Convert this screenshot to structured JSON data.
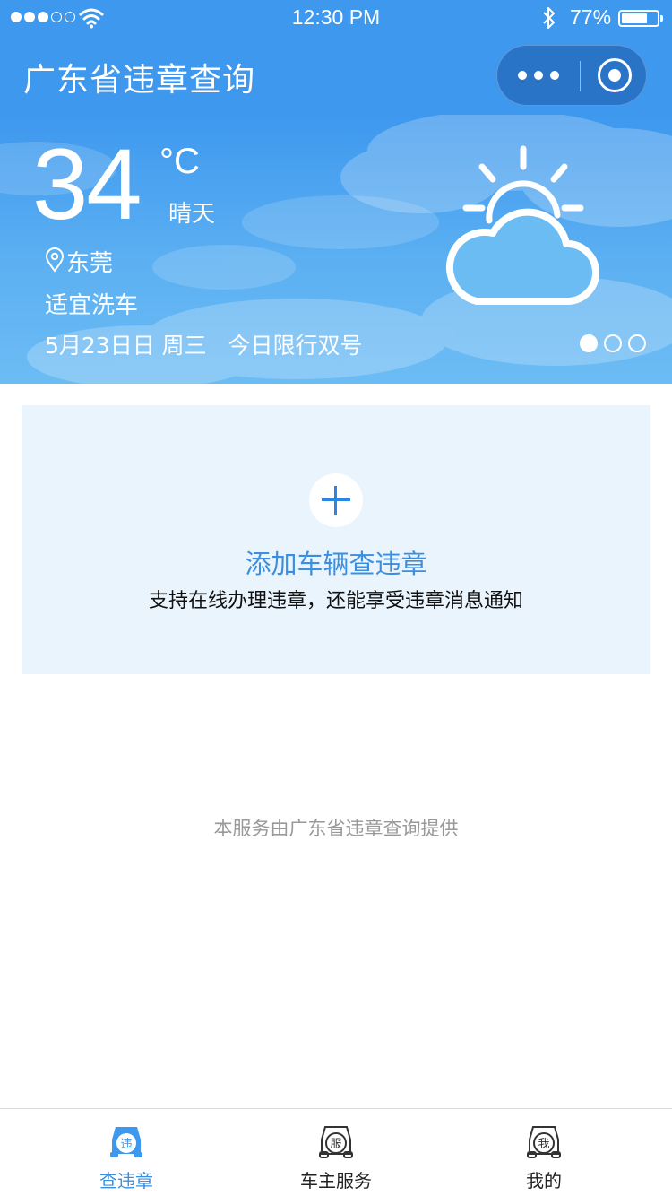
{
  "status_bar": {
    "time": "12:30 PM",
    "battery_percent": "77%",
    "battery_level": 0.77,
    "signal_bars_filled": 3,
    "signal_bars_total": 5
  },
  "nav": {
    "title": "广东省违章查询",
    "more_icon": "more-dots-icon",
    "close_icon": "target-close-icon"
  },
  "weather": {
    "temperature": "34",
    "unit": "°C",
    "condition": "晴天",
    "city": "东莞",
    "car_wash": "适宜洗车",
    "date_line": "5月23日日 周三   今日限行双号",
    "icon": "sun-cloud-icon",
    "pages": 3,
    "active_page": 0
  },
  "add_vehicle": {
    "title": "添加车辆查违章",
    "subtitle": "支持在线办理违章，还能享受违章消息通知"
  },
  "footer": {
    "provider": "本服务由广东省违章查询提供"
  },
  "tab_bar": {
    "tabs": [
      {
        "label": "查违章",
        "badge": "违",
        "active": true
      },
      {
        "label": "车主服务",
        "badge": "服",
        "active": false
      },
      {
        "label": "我的",
        "badge": "我",
        "active": false
      }
    ]
  },
  "colors": {
    "primary": "#3e98ee",
    "accent_text": "#3a8fe0",
    "card_bg": "#eaf4fd",
    "muted_text": "#999999"
  }
}
